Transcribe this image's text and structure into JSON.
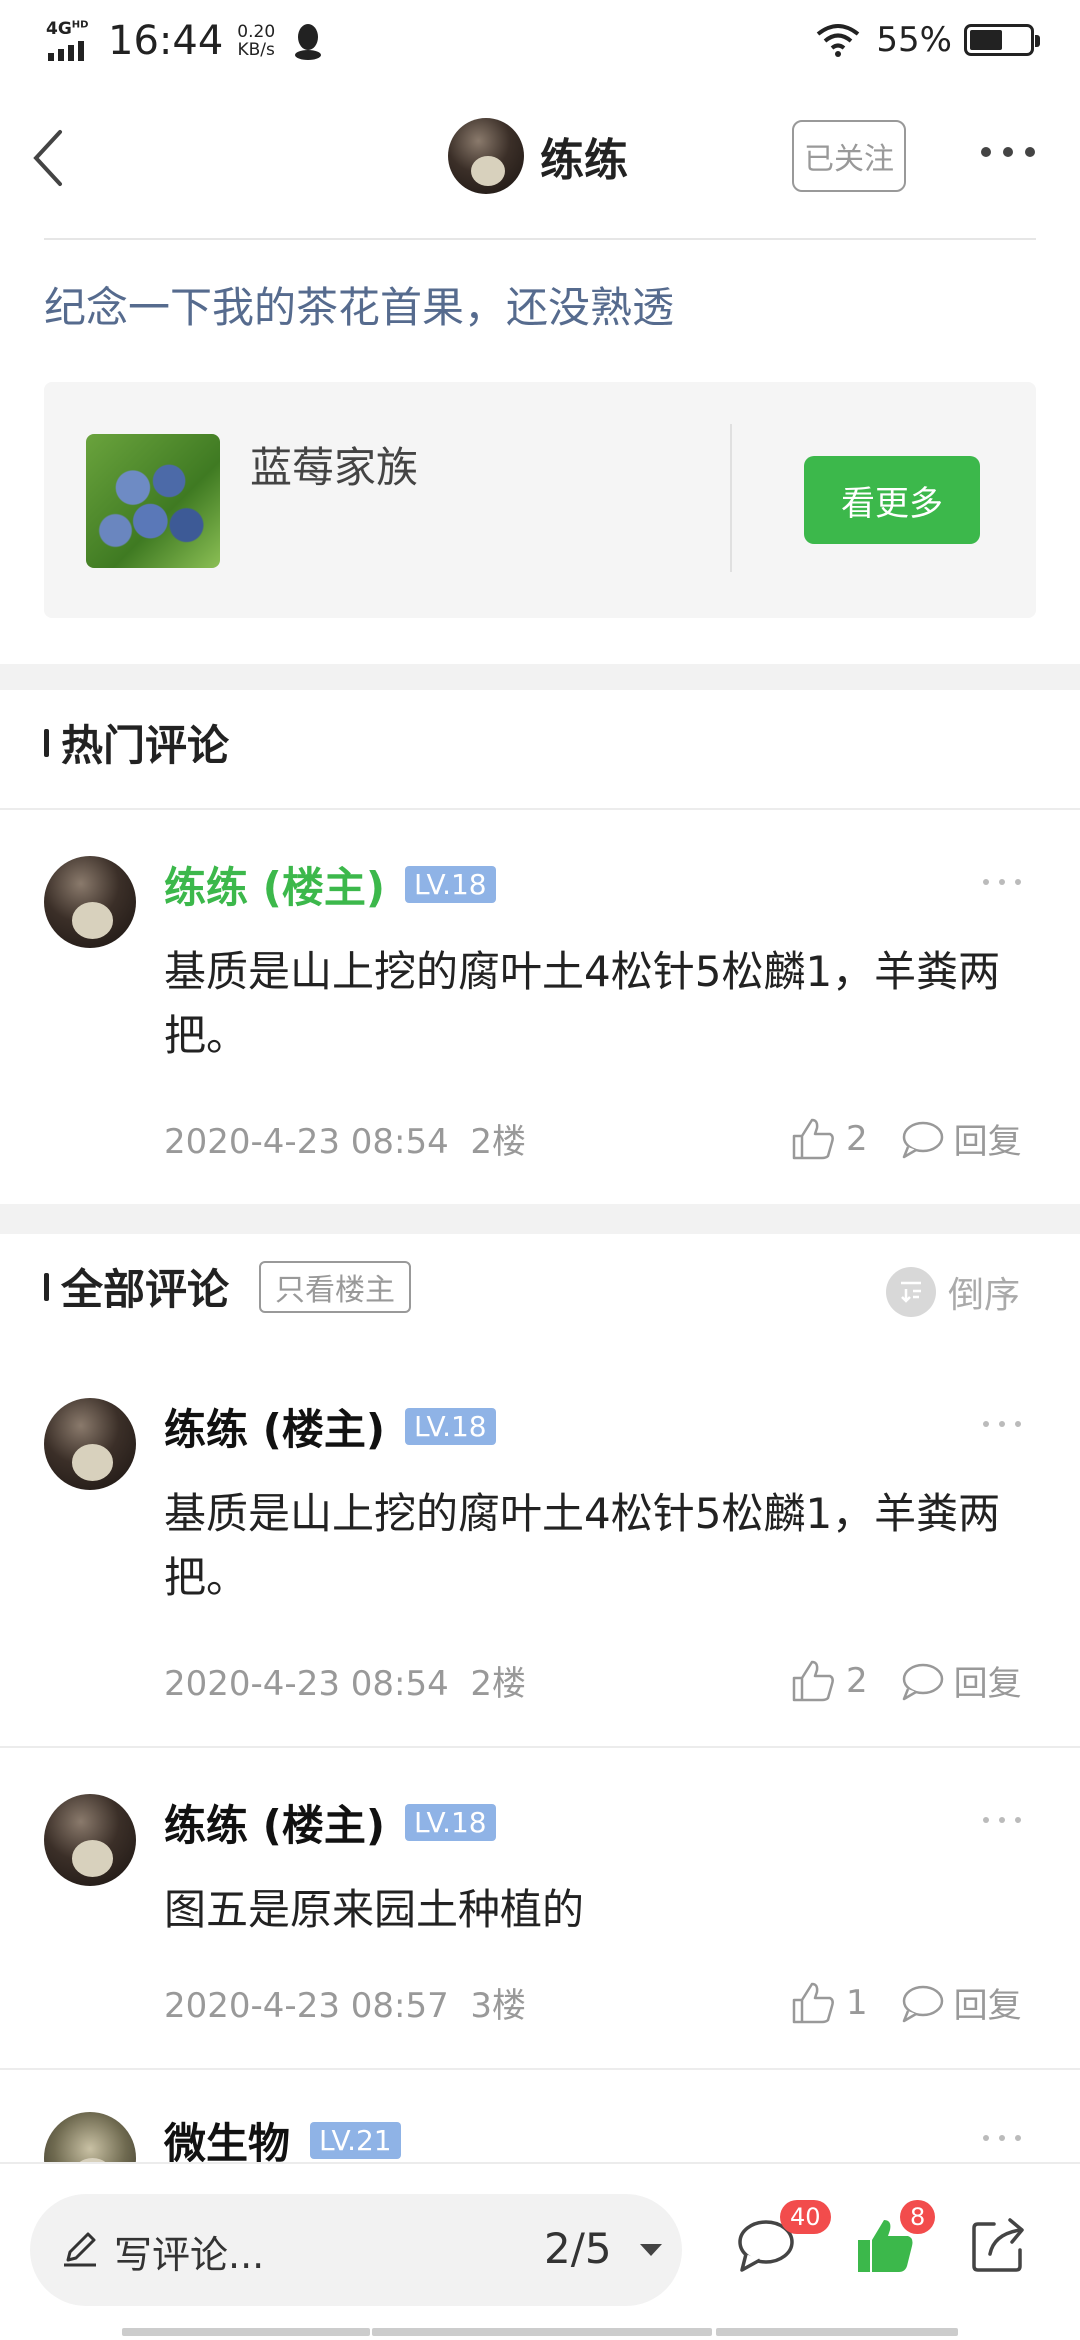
{
  "status_bar": {
    "network": "4G",
    "network_sup": "HD",
    "time": "16:44",
    "speed_value": "0.20",
    "speed_unit": "KB/s",
    "battery": "55%",
    "battery_level": 0.55
  },
  "header": {
    "username": "练练",
    "follow_label": "已关注"
  },
  "post": {
    "title": "纪念一下我的茶花首果，还没熟透"
  },
  "group_card": {
    "name": "蓝莓家族",
    "button_label": "看更多"
  },
  "hot_section": {
    "title": "热门评论"
  },
  "all_section": {
    "title": "全部评论",
    "filter_label": "只看楼主",
    "order_label": "倒序"
  },
  "hot_comments": [
    {
      "name": "练练 (楼主)",
      "level": "LV.18",
      "text": "基质是山上挖的腐叶土4松针5松麟1，羊粪两把。",
      "time": "2020-4-23 08:54",
      "floor": "2楼",
      "likes": "2",
      "reply_label": "回复"
    }
  ],
  "comments": [
    {
      "name": "练练 (楼主)",
      "level": "LV.18",
      "text": "基质是山上挖的腐叶土4松针5松麟1，羊粪两把。",
      "time": "2020-4-23 08:54",
      "floor": "2楼",
      "likes": "2",
      "reply_label": "回复"
    },
    {
      "name": "练练 (楼主)",
      "level": "LV.18",
      "text": "图五是原来园土种植的",
      "time": "2020-4-23 08:57",
      "floor": "3楼",
      "likes": "1",
      "reply_label": "回复"
    },
    {
      "name": "微生物",
      "level": "LV.21"
    }
  ],
  "bottom_bar": {
    "write_placeholder": "写评论...",
    "page_indicator": "2/5",
    "comment_badge": "40",
    "like_badge": "8"
  },
  "colors": {
    "accent_green": "#3cb84b",
    "link_blue": "#566b8e",
    "level_badge": "#8fb3e6",
    "badge_red": "#f24c4c"
  }
}
